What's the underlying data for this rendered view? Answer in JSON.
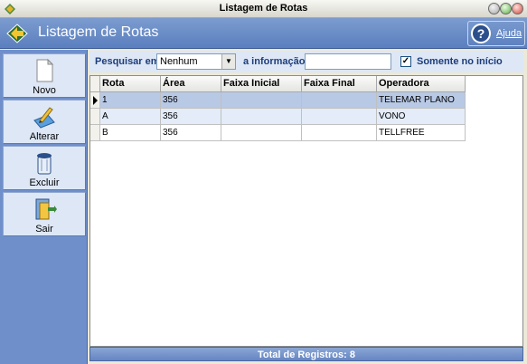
{
  "window": {
    "title": "Listagem de Rotas"
  },
  "header": {
    "title": "Listagem de Rotas",
    "help_label": "Ajuda"
  },
  "sidebar": {
    "items": [
      {
        "label": "Novo",
        "icon": "new-document-icon"
      },
      {
        "label": "Alterar",
        "icon": "edit-icon"
      },
      {
        "label": "Excluir",
        "icon": "trash-icon"
      },
      {
        "label": "Sair",
        "icon": "exit-door-icon"
      }
    ]
  },
  "filter": {
    "search_label": "Pesquisar em",
    "field_value": "Nenhum",
    "info_label": "a informação",
    "info_value": "",
    "only_start_label": "Somente no início",
    "only_start_checked": "✓"
  },
  "grid": {
    "columns": [
      "Rota",
      "Área",
      "Faixa Inicial",
      "Faixa Final",
      "Operadora"
    ],
    "rows": [
      [
        "1",
        "356",
        "",
        "",
        "TELEMAR PLANO"
      ],
      [
        "A",
        "356",
        "",
        "",
        "VONO"
      ],
      [
        "B",
        "356",
        "",
        "",
        "TELLFREE"
      ]
    ]
  },
  "footer": {
    "total_label": "Total de Registros: 8"
  },
  "colors": {
    "accent": "#5b7fbf",
    "sidebar": "#6f8fcb",
    "selected_row": "#b8c9e6"
  }
}
